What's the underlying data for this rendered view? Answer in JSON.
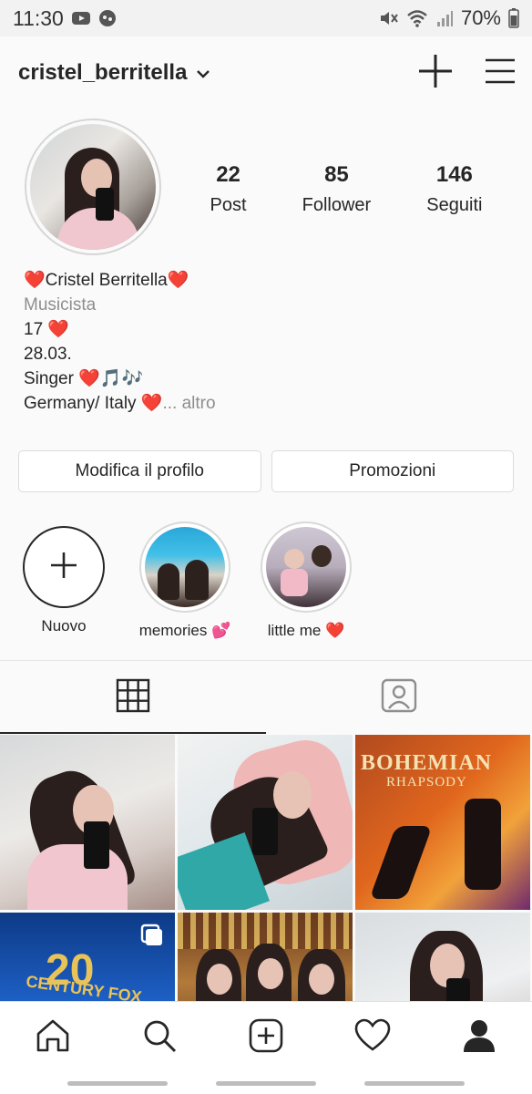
{
  "status_bar": {
    "time": "11:30",
    "battery": "70%",
    "icons": [
      "youtube-icon",
      "game-icon",
      "mute-icon",
      "wifi-icon",
      "signal-icon",
      "battery-icon"
    ]
  },
  "header": {
    "username": "cristel_berritella"
  },
  "stats": [
    {
      "value": "22",
      "label": "Post"
    },
    {
      "value": "85",
      "label": "Follower"
    },
    {
      "value": "146",
      "label": "Seguiti"
    }
  ],
  "bio": {
    "name": "❤️Cristel Berritella❤️",
    "category": "Musicista",
    "line1": "17 ❤️",
    "line2": "28.03.",
    "line3": "Singer ❤️🎵🎶",
    "line4": "Germany/ Italy ❤️",
    "more": "... altro"
  },
  "buttons": {
    "edit_profile": "Modifica il profilo",
    "promotions": "Promozioni"
  },
  "highlights": [
    {
      "label": "Nuovo"
    },
    {
      "label": "memories 💕"
    },
    {
      "label": "little me ❤️"
    }
  ],
  "colors": {
    "text": "#262626",
    "muted": "#8e8e8e",
    "border": "#dbdbdb",
    "heart": "#ed1c3c"
  }
}
